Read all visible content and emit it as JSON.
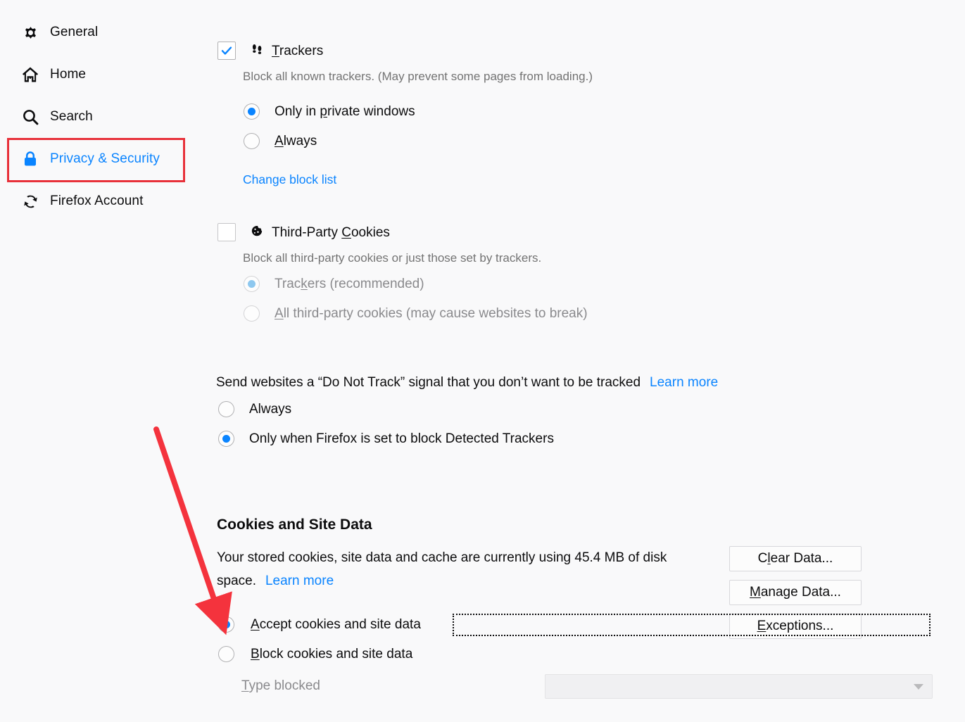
{
  "sidebar": {
    "items": [
      {
        "label": "General",
        "icon": "gear-icon",
        "selected": false
      },
      {
        "label": "Home",
        "icon": "home-icon",
        "selected": false
      },
      {
        "label": "Search",
        "icon": "search-icon",
        "selected": false
      },
      {
        "label": "Privacy & Security",
        "icon": "lock-icon",
        "selected": true
      },
      {
        "label": "Firefox Account",
        "icon": "sync-icon",
        "selected": false
      }
    ]
  },
  "trackers": {
    "checkbox_label": "Trackers",
    "checked": true,
    "icon": "footprints-icon",
    "description": "Block all known trackers. (May prevent some pages from loading.)",
    "options": [
      {
        "label": "Only in private windows",
        "selected": true
      },
      {
        "label": "Always",
        "selected": false
      }
    ],
    "change_block_list_link": "Change block list"
  },
  "third_party_cookies": {
    "checkbox_label": "Third-Party Cookies",
    "checked": false,
    "disabled": true,
    "icon": "cookie-icon",
    "description": "Block all third-party cookies or just those set by trackers.",
    "options": [
      {
        "label": "Trackers (recommended)",
        "selected": true
      },
      {
        "label": "All third-party cookies (may cause websites to break)",
        "selected": false
      }
    ]
  },
  "do_not_track": {
    "text": "Send websites a “Do Not Track” signal that you don’t want to be tracked",
    "learn_more": "Learn more",
    "options": [
      {
        "label": "Always",
        "selected": false
      },
      {
        "label": "Only when Firefox is set to block Detected Trackers",
        "selected": true
      }
    ]
  },
  "cookies_and_site_data": {
    "title": "Cookies and Site Data",
    "description_part1": "Your stored cookies, site data and cache are currently using 45.4 MB of disk",
    "description_part2": "space.",
    "usage": "45.4 MB",
    "learn_more": "Learn more",
    "buttons": [
      {
        "label": "Clear Data..."
      },
      {
        "label": "Manage Data..."
      },
      {
        "label": "Exceptions..."
      }
    ],
    "options": [
      {
        "label": "Accept cookies and site data",
        "selected": true,
        "focused": true
      },
      {
        "label": "Block cookies and site data",
        "selected": false,
        "focused": false
      }
    ],
    "type_blocked_label": "Type blocked",
    "type_blocked_value": "",
    "type_blocked_disabled": true
  },
  "colors": {
    "accent": "#0a84ff",
    "annotation": "#e8313a",
    "background": "#f9f9fa",
    "text": "#0c0c0d",
    "muted": "#737373"
  }
}
